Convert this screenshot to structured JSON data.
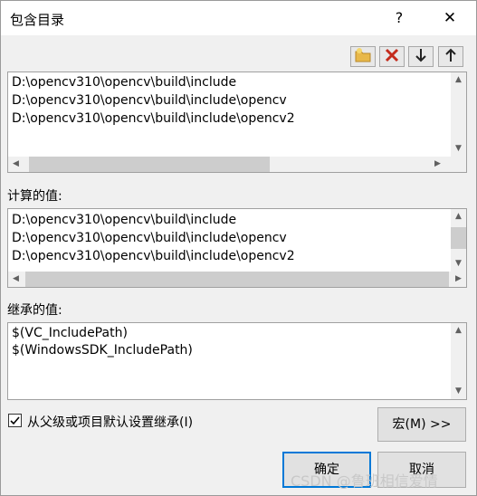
{
  "window": {
    "title": "包含目录",
    "help_label": "?",
    "close_label": "✕"
  },
  "toolbar": {
    "new_line_icon": "new-folder-icon",
    "delete_icon": "delete-icon",
    "move_down_icon": "arrow-down-icon",
    "move_up_icon": "arrow-up-icon"
  },
  "edit_list": {
    "lines": [
      "D:\\opencv310\\opencv\\build\\include",
      "D:\\opencv310\\opencv\\build\\include\\opencv",
      "D:\\opencv310\\opencv\\build\\include\\opencv2"
    ]
  },
  "computed": {
    "label": "计算的值:",
    "lines": [
      "D:\\opencv310\\opencv\\build\\include",
      "D:\\opencv310\\opencv\\build\\include\\opencv",
      "D:\\opencv310\\opencv\\build\\include\\opencv2"
    ]
  },
  "inherited": {
    "label": "继承的值:",
    "lines": [
      "$(VC_IncludePath)",
      "$(WindowsSDK_IncludePath)"
    ]
  },
  "inherit_checkbox": {
    "label": "从父级或项目默认设置继承(I)",
    "checked": true
  },
  "buttons": {
    "macro": "宏(M) >>",
    "ok": "确定",
    "cancel": "取消"
  },
  "watermark": "CSDN @鲁班相信爱情",
  "colors": {
    "accent": "#0078d7",
    "delete_red": "#c42b1c"
  }
}
